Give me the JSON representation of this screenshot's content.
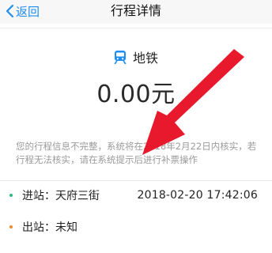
{
  "nav": {
    "back_label": "返回",
    "title": "行程详情"
  },
  "transport": {
    "icon": "metro-icon",
    "label": "地铁"
  },
  "amount": "0.00元",
  "notice": "您的行程信息不完整，系统将在2018年2月22日内核实，若行程无法核实，请在系统提示后进行补票操作",
  "entry": {
    "label": "进站：天府三街",
    "time": "2018-02-20 17:42:06",
    "dot_color": "#2bbf7e"
  },
  "exit": {
    "label": "出站：未知",
    "dot_color": "#f28a2e"
  },
  "colors": {
    "accent": "#1f8ef1",
    "arrow": "#e8192c"
  }
}
